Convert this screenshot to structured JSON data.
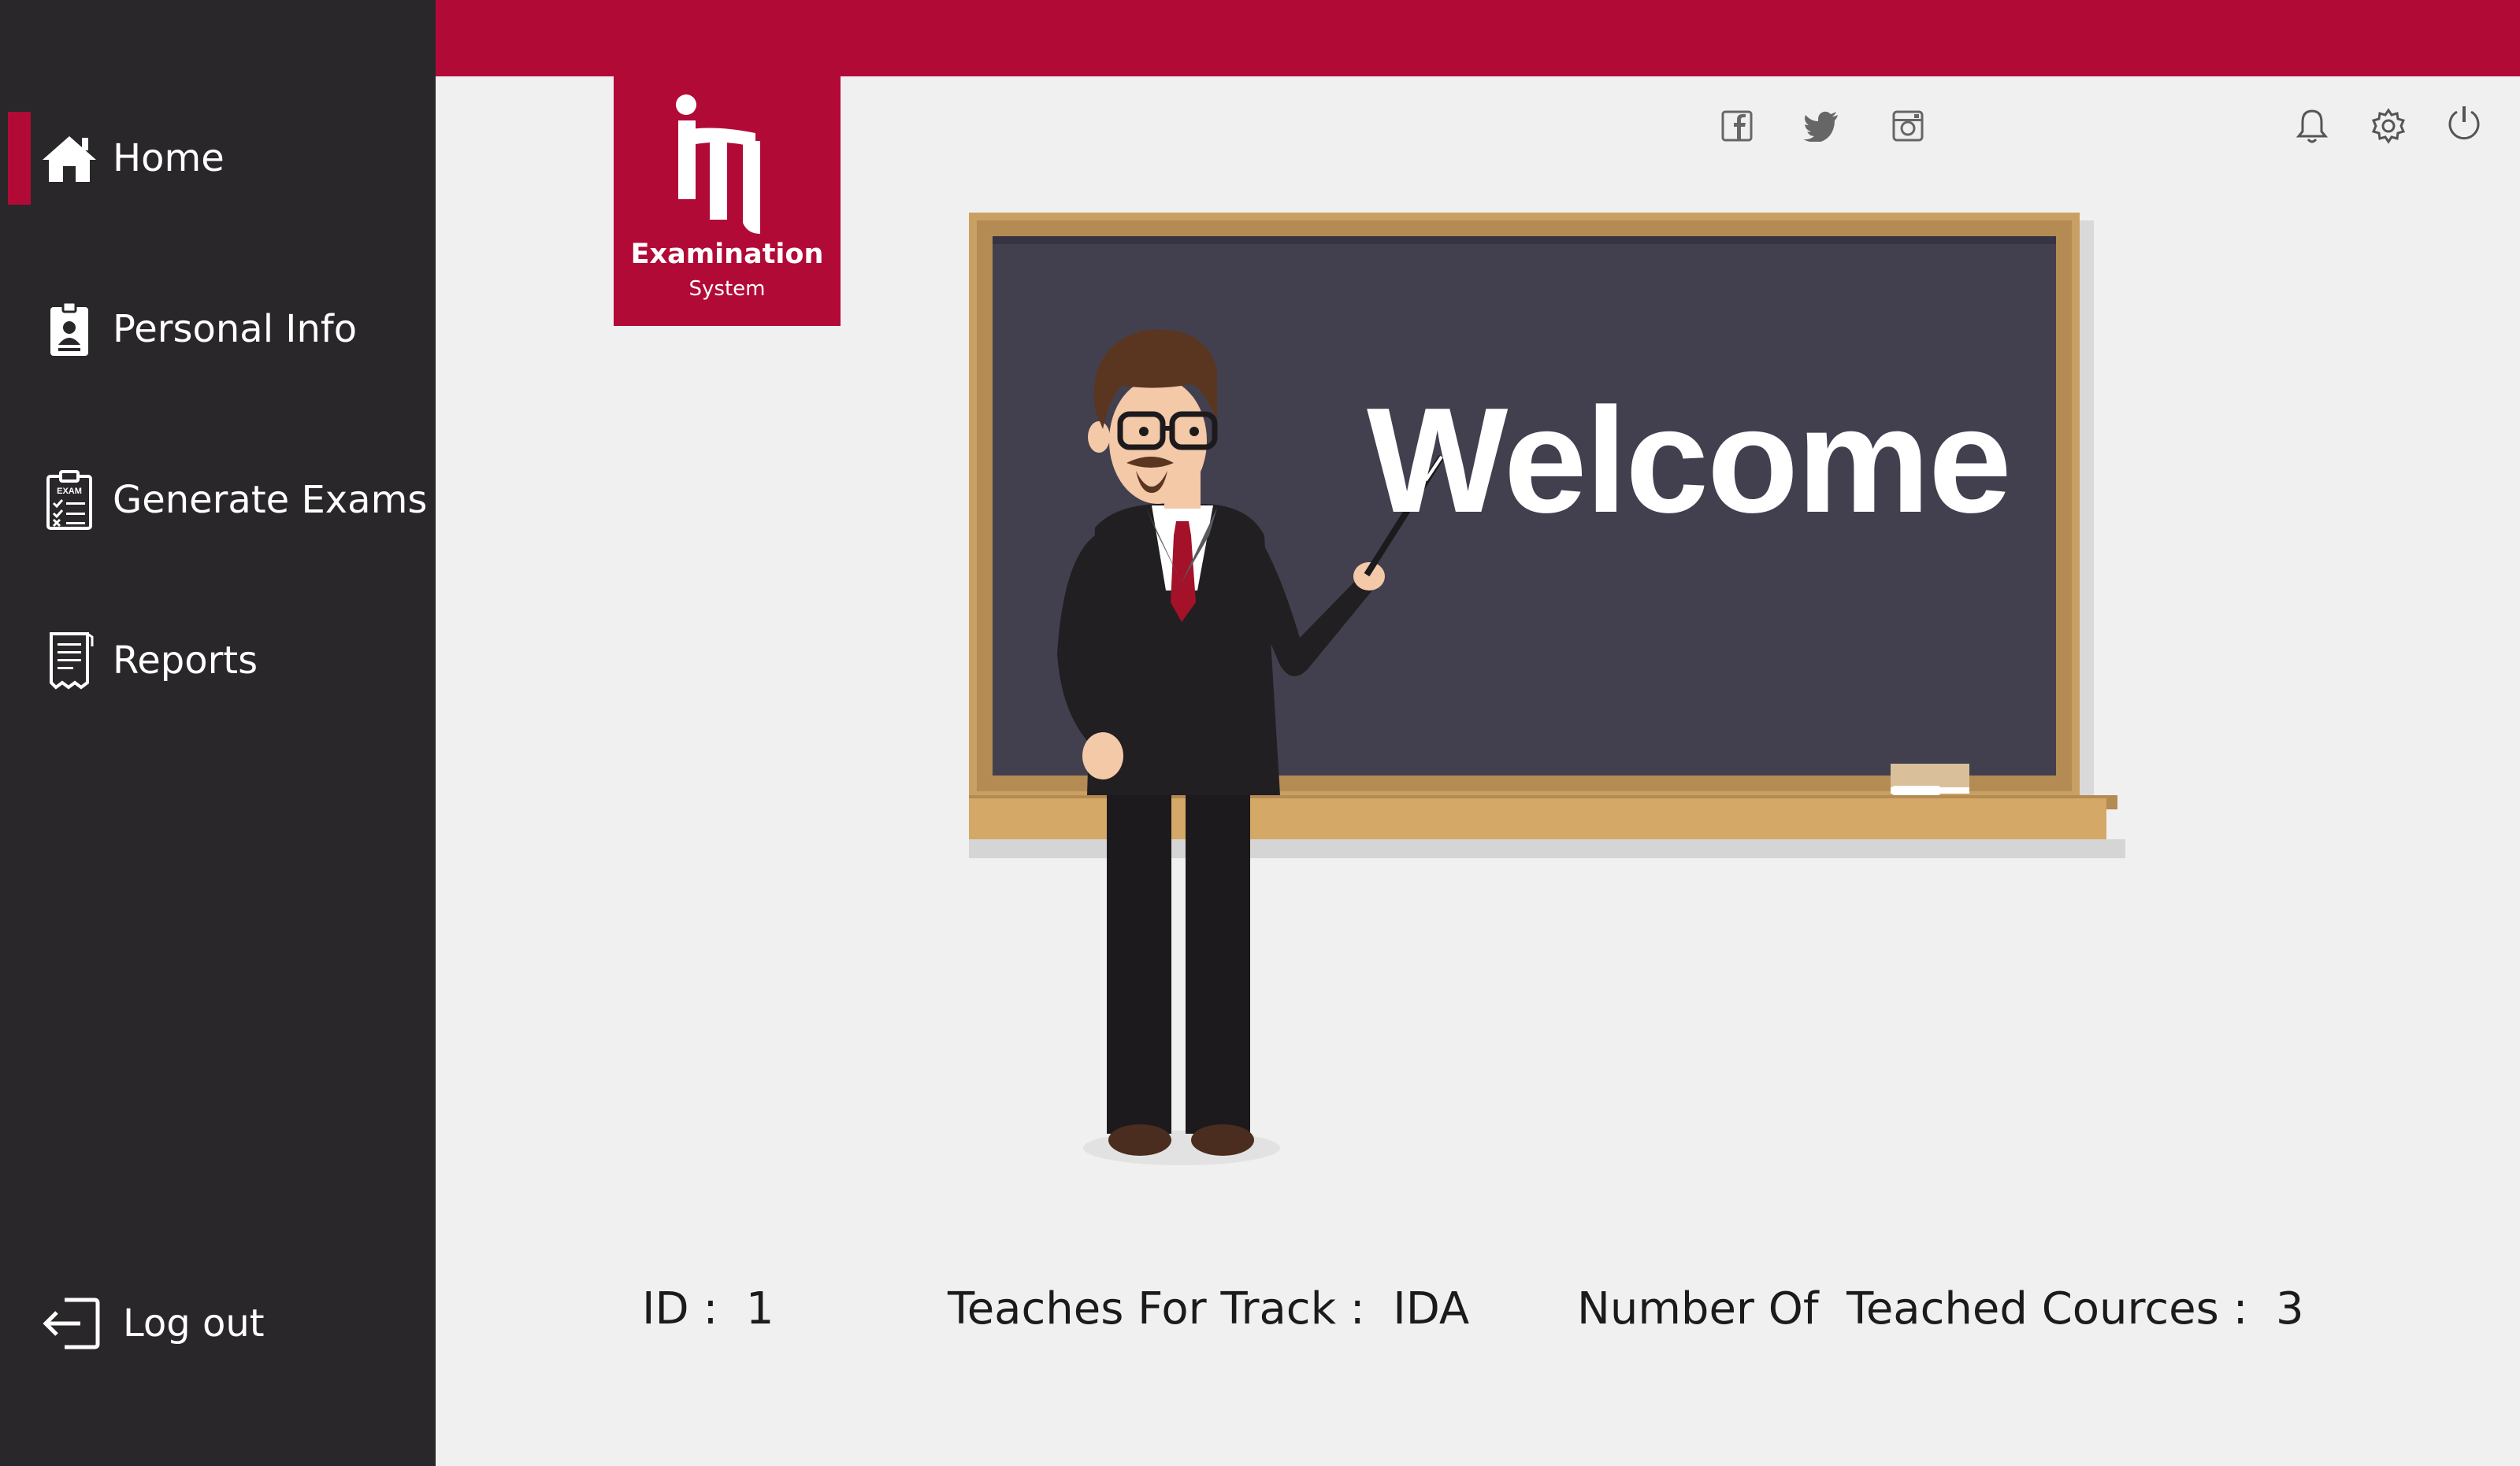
{
  "sidebar": {
    "items": [
      {
        "label": "Home",
        "icon": "home-icon",
        "active": true
      },
      {
        "label": "Personal Info",
        "icon": "id-card-icon"
      },
      {
        "label": "Generate Exams",
        "icon": "exam-clipboard-icon"
      },
      {
        "label": "Reports",
        "icon": "report-document-icon"
      }
    ],
    "logout_label": "Log out"
  },
  "logo": {
    "mark": "iTi",
    "title": "Examination",
    "subtitle": "System"
  },
  "social": [
    "facebook-icon",
    "twitter-icon",
    "instagram-icon"
  ],
  "actions": [
    "bell-icon",
    "gear-icon",
    "power-icon"
  ],
  "hero": {
    "board_text": "Welcome"
  },
  "info": {
    "id_label": "ID :  1",
    "track_label": "Teaches For Track :  IDA",
    "courses_label": "Number Of  Teached Cources :  3"
  },
  "colors": {
    "brand_red": "#b20a37",
    "sidebar_bg": "#292729",
    "content_bg": "#f0f0f0",
    "board_bg": "#42404e",
    "board_frame": "#c9a063"
  }
}
